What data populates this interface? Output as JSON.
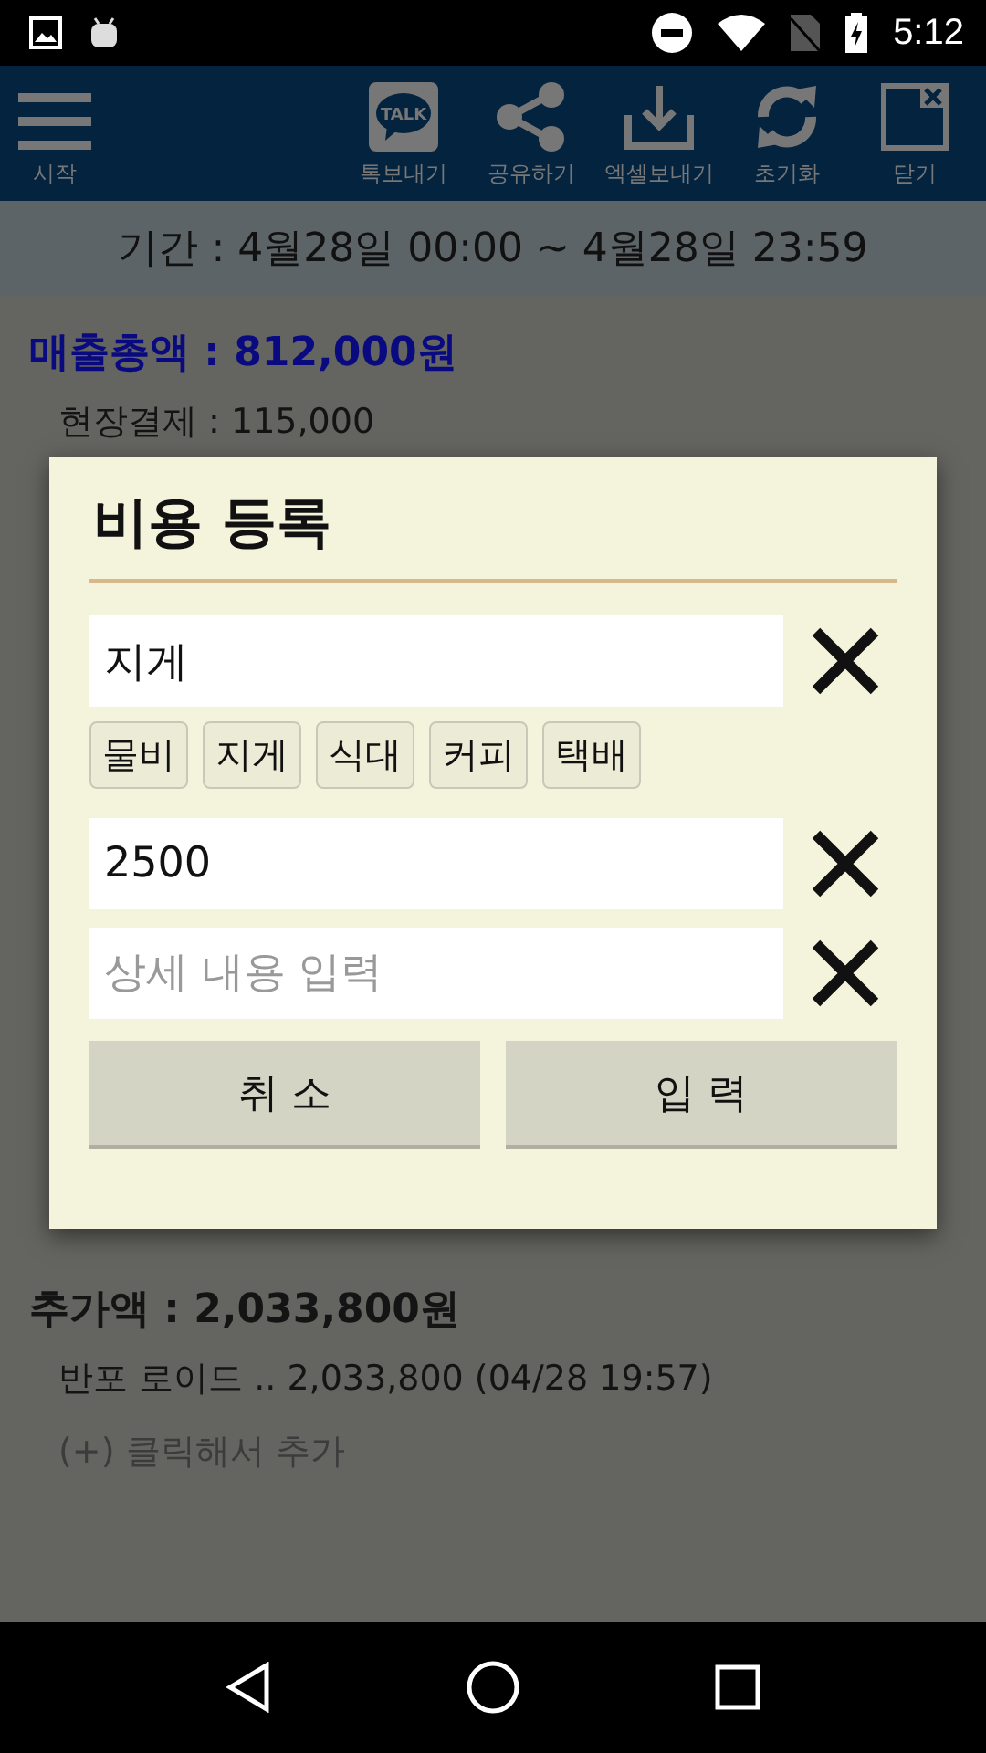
{
  "status_bar": {
    "time": "5:12"
  },
  "toolbar": {
    "menu_label": "시작",
    "actions": [
      {
        "kind": "talk",
        "label": "톡보내기",
        "icon_text": "TALK"
      },
      {
        "kind": "share",
        "label": "공유하기"
      },
      {
        "kind": "download",
        "label": "엑셀보내기"
      },
      {
        "kind": "refresh",
        "label": "초기화"
      },
      {
        "kind": "close",
        "label": "닫기"
      }
    ]
  },
  "period": "기간 : 4월28일 00:00 ~ 4월28일 23:59",
  "sales": {
    "title": "매출총액 : 812,000원",
    "items": [
      "현장결제 : 115,000"
    ]
  },
  "extra": {
    "title": "추가액 : 2,033,800원",
    "items": [
      "반포 로이드 .. 2,033,800 (04/28 19:57)"
    ],
    "add": "(+) 클릭해서 추가"
  },
  "dialog": {
    "title": "비용 등록",
    "fields": [
      {
        "value": "지게"
      },
      {
        "value": "2500"
      },
      {
        "placeholder": "상세 내용 입력"
      }
    ],
    "chips": [
      "물비",
      "지게",
      "식대",
      "커피",
      "택배"
    ],
    "buttons": [
      "취 소",
      "입 력"
    ]
  }
}
